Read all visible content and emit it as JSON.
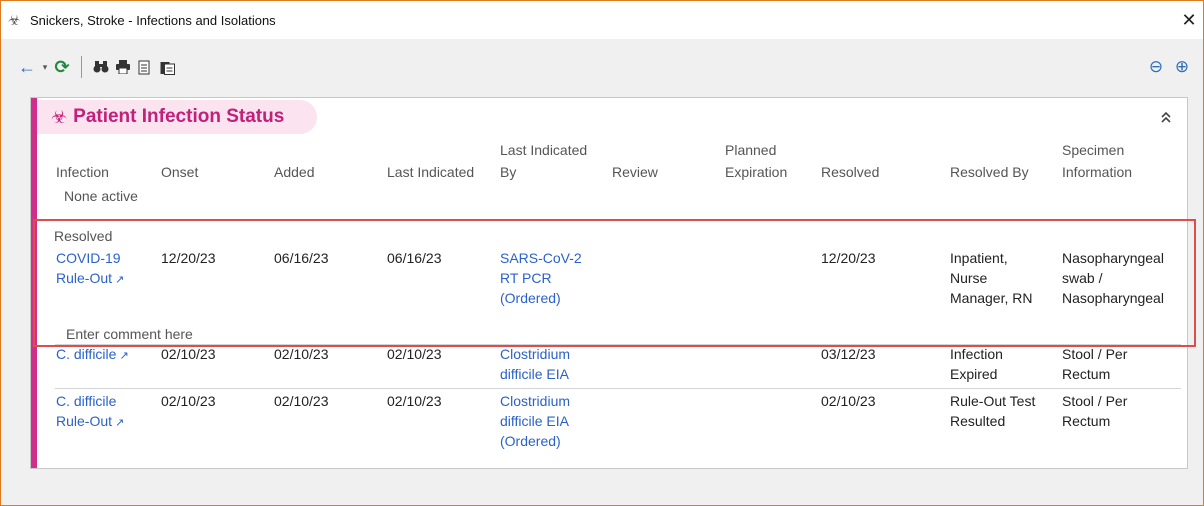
{
  "window": {
    "title": "Snickers, Stroke - Infections and Isolations",
    "close_glyph": "✕"
  },
  "toolbar": {
    "back_glyph": "←",
    "drop_glyph": "▾",
    "refresh_glyph": "⟳",
    "find_glyph": "⛊",
    "print_glyph": "⎙",
    "copy_glyph": "▤",
    "paste_glyph": "▥",
    "zoom_out_glyph": "⊖",
    "zoom_in_glyph": "⊕"
  },
  "card": {
    "title": "Patient Infection Status",
    "icon_glyph": "☣",
    "collapse_glyph": "⌃",
    "columns": [
      "Infection",
      "Onset",
      "Added",
      "Last Indicated",
      "Last Indicated By",
      "Review",
      "Planned Expiration",
      "Resolved",
      "Resolved By",
      "Specimen Information"
    ],
    "col_last_ind_by_1": "Last Indicated",
    "col_last_ind_by_2": "By",
    "col_planned_1": "Planned",
    "col_planned_2": "Expiration",
    "col_specimen_1": "Specimen",
    "col_specimen_2": "Information",
    "none_active": "None active",
    "resolved_label": "Resolved",
    "comment_placeholder": "Enter comment here",
    "rows": [
      {
        "infection_1": "COVID-19",
        "infection_2": "Rule-Out",
        "onset": "12/20/23",
        "added": "06/16/23",
        "last_indicated": "06/16/23",
        "by_1": "SARS-CoV-2",
        "by_2": "RT PCR",
        "by_3": "(Ordered)",
        "resolved": "12/20/23",
        "resolved_by_1": "Inpatient,",
        "resolved_by_2": "Nurse",
        "resolved_by_3": "Manager, RN",
        "specimen_1": "Nasopharyngeal",
        "specimen_2": "swab /",
        "specimen_3": "Nasopharyngeal"
      },
      {
        "infection_1": "C. difficile",
        "onset": "02/10/23",
        "added": "02/10/23",
        "last_indicated": "02/10/23",
        "by_1": "Clostridium",
        "by_2": "difficile EIA",
        "resolved": "03/12/23",
        "resolved_by_1": "Infection",
        "resolved_by_2": "Expired",
        "specimen_1": "Stool / Per",
        "specimen_2": "Rectum"
      },
      {
        "infection_1": "C. difficile",
        "infection_2": "Rule-Out",
        "onset": "02/10/23",
        "added": "02/10/23",
        "last_indicated": "02/10/23",
        "by_1": "Clostridium",
        "by_2": "difficile EIA",
        "by_3": "(Ordered)",
        "resolved": "02/10/23",
        "resolved_by_1": "Rule-Out Test",
        "resolved_by_2": "Resulted",
        "specimen_1": "Stool / Per",
        "specimen_2": "Rectum"
      }
    ],
    "ext_link_glyph": "↗"
  },
  "colors": {
    "accent": "#cf2f8b",
    "link": "#2a62c9",
    "highlight": "#e04b4b",
    "window_border": "#e07a1f"
  }
}
